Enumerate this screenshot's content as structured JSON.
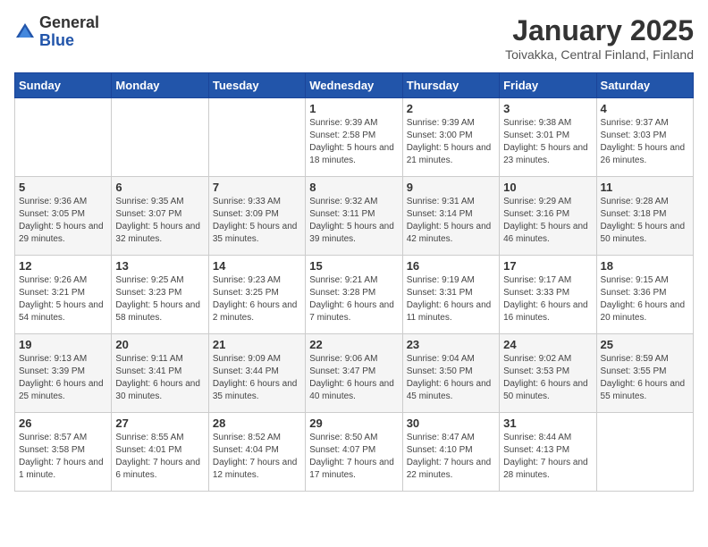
{
  "header": {
    "logo_general": "General",
    "logo_blue": "Blue",
    "title": "January 2025",
    "subtitle": "Toivakka, Central Finland, Finland"
  },
  "weekdays": [
    "Sunday",
    "Monday",
    "Tuesday",
    "Wednesday",
    "Thursday",
    "Friday",
    "Saturday"
  ],
  "weeks": [
    [
      {
        "day": "",
        "empty": true
      },
      {
        "day": "",
        "empty": true
      },
      {
        "day": "",
        "empty": true
      },
      {
        "day": "1",
        "sunrise": "Sunrise: 9:39 AM",
        "sunset": "Sunset: 2:58 PM",
        "daylight": "Daylight: 5 hours and 18 minutes."
      },
      {
        "day": "2",
        "sunrise": "Sunrise: 9:39 AM",
        "sunset": "Sunset: 3:00 PM",
        "daylight": "Daylight: 5 hours and 21 minutes."
      },
      {
        "day": "3",
        "sunrise": "Sunrise: 9:38 AM",
        "sunset": "Sunset: 3:01 PM",
        "daylight": "Daylight: 5 hours and 23 minutes."
      },
      {
        "day": "4",
        "sunrise": "Sunrise: 9:37 AM",
        "sunset": "Sunset: 3:03 PM",
        "daylight": "Daylight: 5 hours and 26 minutes."
      }
    ],
    [
      {
        "day": "5",
        "sunrise": "Sunrise: 9:36 AM",
        "sunset": "Sunset: 3:05 PM",
        "daylight": "Daylight: 5 hours and 29 minutes."
      },
      {
        "day": "6",
        "sunrise": "Sunrise: 9:35 AM",
        "sunset": "Sunset: 3:07 PM",
        "daylight": "Daylight: 5 hours and 32 minutes."
      },
      {
        "day": "7",
        "sunrise": "Sunrise: 9:33 AM",
        "sunset": "Sunset: 3:09 PM",
        "daylight": "Daylight: 5 hours and 35 minutes."
      },
      {
        "day": "8",
        "sunrise": "Sunrise: 9:32 AM",
        "sunset": "Sunset: 3:11 PM",
        "daylight": "Daylight: 5 hours and 39 minutes."
      },
      {
        "day": "9",
        "sunrise": "Sunrise: 9:31 AM",
        "sunset": "Sunset: 3:14 PM",
        "daylight": "Daylight: 5 hours and 42 minutes."
      },
      {
        "day": "10",
        "sunrise": "Sunrise: 9:29 AM",
        "sunset": "Sunset: 3:16 PM",
        "daylight": "Daylight: 5 hours and 46 minutes."
      },
      {
        "day": "11",
        "sunrise": "Sunrise: 9:28 AM",
        "sunset": "Sunset: 3:18 PM",
        "daylight": "Daylight: 5 hours and 50 minutes."
      }
    ],
    [
      {
        "day": "12",
        "sunrise": "Sunrise: 9:26 AM",
        "sunset": "Sunset: 3:21 PM",
        "daylight": "Daylight: 5 hours and 54 minutes."
      },
      {
        "day": "13",
        "sunrise": "Sunrise: 9:25 AM",
        "sunset": "Sunset: 3:23 PM",
        "daylight": "Daylight: 5 hours and 58 minutes."
      },
      {
        "day": "14",
        "sunrise": "Sunrise: 9:23 AM",
        "sunset": "Sunset: 3:25 PM",
        "daylight": "Daylight: 6 hours and 2 minutes."
      },
      {
        "day": "15",
        "sunrise": "Sunrise: 9:21 AM",
        "sunset": "Sunset: 3:28 PM",
        "daylight": "Daylight: 6 hours and 7 minutes."
      },
      {
        "day": "16",
        "sunrise": "Sunrise: 9:19 AM",
        "sunset": "Sunset: 3:31 PM",
        "daylight": "Daylight: 6 hours and 11 minutes."
      },
      {
        "day": "17",
        "sunrise": "Sunrise: 9:17 AM",
        "sunset": "Sunset: 3:33 PM",
        "daylight": "Daylight: 6 hours and 16 minutes."
      },
      {
        "day": "18",
        "sunrise": "Sunrise: 9:15 AM",
        "sunset": "Sunset: 3:36 PM",
        "daylight": "Daylight: 6 hours and 20 minutes."
      }
    ],
    [
      {
        "day": "19",
        "sunrise": "Sunrise: 9:13 AM",
        "sunset": "Sunset: 3:39 PM",
        "daylight": "Daylight: 6 hours and 25 minutes."
      },
      {
        "day": "20",
        "sunrise": "Sunrise: 9:11 AM",
        "sunset": "Sunset: 3:41 PM",
        "daylight": "Daylight: 6 hours and 30 minutes."
      },
      {
        "day": "21",
        "sunrise": "Sunrise: 9:09 AM",
        "sunset": "Sunset: 3:44 PM",
        "daylight": "Daylight: 6 hours and 35 minutes."
      },
      {
        "day": "22",
        "sunrise": "Sunrise: 9:06 AM",
        "sunset": "Sunset: 3:47 PM",
        "daylight": "Daylight: 6 hours and 40 minutes."
      },
      {
        "day": "23",
        "sunrise": "Sunrise: 9:04 AM",
        "sunset": "Sunset: 3:50 PM",
        "daylight": "Daylight: 6 hours and 45 minutes."
      },
      {
        "day": "24",
        "sunrise": "Sunrise: 9:02 AM",
        "sunset": "Sunset: 3:53 PM",
        "daylight": "Daylight: 6 hours and 50 minutes."
      },
      {
        "day": "25",
        "sunrise": "Sunrise: 8:59 AM",
        "sunset": "Sunset: 3:55 PM",
        "daylight": "Daylight: 6 hours and 55 minutes."
      }
    ],
    [
      {
        "day": "26",
        "sunrise": "Sunrise: 8:57 AM",
        "sunset": "Sunset: 3:58 PM",
        "daylight": "Daylight: 7 hours and 1 minute."
      },
      {
        "day": "27",
        "sunrise": "Sunrise: 8:55 AM",
        "sunset": "Sunset: 4:01 PM",
        "daylight": "Daylight: 7 hours and 6 minutes."
      },
      {
        "day": "28",
        "sunrise": "Sunrise: 8:52 AM",
        "sunset": "Sunset: 4:04 PM",
        "daylight": "Daylight: 7 hours and 12 minutes."
      },
      {
        "day": "29",
        "sunrise": "Sunrise: 8:50 AM",
        "sunset": "Sunset: 4:07 PM",
        "daylight": "Daylight: 7 hours and 17 minutes."
      },
      {
        "day": "30",
        "sunrise": "Sunrise: 8:47 AM",
        "sunset": "Sunset: 4:10 PM",
        "daylight": "Daylight: 7 hours and 22 minutes."
      },
      {
        "day": "31",
        "sunrise": "Sunrise: 8:44 AM",
        "sunset": "Sunset: 4:13 PM",
        "daylight": "Daylight: 7 hours and 28 minutes."
      },
      {
        "day": "",
        "empty": true
      }
    ]
  ]
}
